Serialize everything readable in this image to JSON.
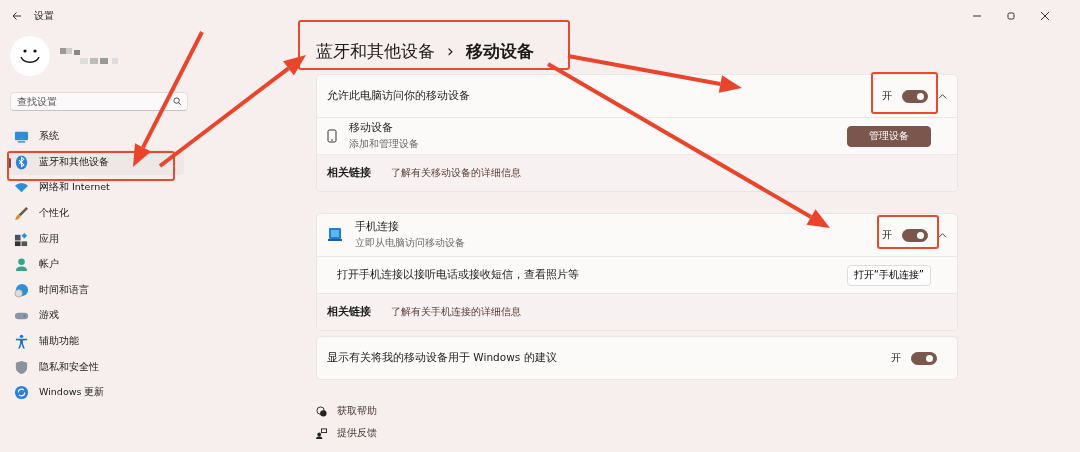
{
  "window": {
    "title": "设置"
  },
  "search": {
    "placeholder": "查找设置"
  },
  "nav": [
    {
      "label": "系统",
      "selected": false
    },
    {
      "label": "蓝牙和其他设备",
      "selected": true
    },
    {
      "label": "网络和 Internet",
      "selected": false
    },
    {
      "label": "个性化",
      "selected": false
    },
    {
      "label": "应用",
      "selected": false
    },
    {
      "label": "帐户",
      "selected": false
    },
    {
      "label": "时间和语言",
      "selected": false
    },
    {
      "label": "游戏",
      "selected": false
    },
    {
      "label": "辅助功能",
      "selected": false
    },
    {
      "label": "隐私和安全性",
      "selected": false
    },
    {
      "label": "Windows 更新",
      "selected": false
    }
  ],
  "breadcrumb": {
    "parent": "蓝牙和其他设备",
    "separator": "›",
    "current": "移动设备"
  },
  "cards": [
    {
      "header": {
        "title": "允许此电脑访问你的移动设备",
        "toggle_label": "开",
        "on": true,
        "expanded": true
      },
      "rows": [
        {
          "kind": "device",
          "title": "移动设备",
          "subtitle": "添加和管理设备",
          "button": "管理设备",
          "primary": true
        }
      ],
      "related": {
        "label": "相关链接",
        "link": "了解有关移动设备的详细信息"
      }
    },
    {
      "header": {
        "title": "手机连接",
        "subtitle": "立即从电脑访问移动设备",
        "toggle_label": "开",
        "on": true,
        "expanded": true
      },
      "rows": [
        {
          "kind": "text",
          "title": "打开手机连接以接听电话或接收短信，查看照片等",
          "button": "打开“手机连接”",
          "primary": false
        }
      ],
      "related": {
        "label": "相关链接",
        "link": "了解有关手机连接的详细信息"
      }
    },
    {
      "header": {
        "title": "显示有关将我的移动设备用于 Windows 的建议",
        "toggle_label": "开",
        "on": true
      }
    }
  ],
  "footer_links": [
    {
      "label": "获取帮助"
    },
    {
      "label": "提供反馈"
    }
  ]
}
